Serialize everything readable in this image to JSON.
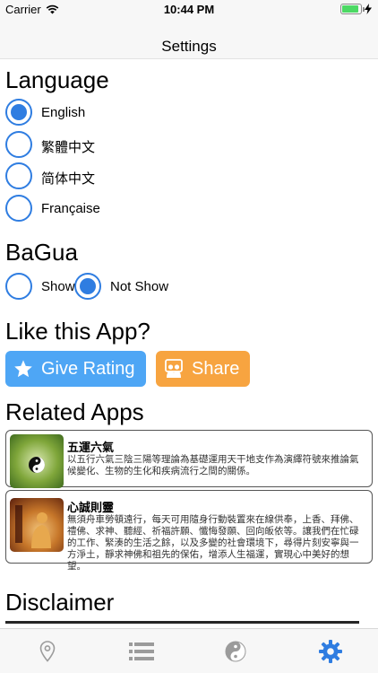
{
  "status_bar": {
    "carrier": "Carrier",
    "time": "10:44 PM",
    "battery_level": 0.9
  },
  "nav": {
    "title": "Settings"
  },
  "language": {
    "title": "Language",
    "options": [
      {
        "label": "English",
        "selected": true
      },
      {
        "label": "繁體中文",
        "selected": false
      },
      {
        "label": "简体中文",
        "selected": false
      },
      {
        "label": "Française",
        "selected": false
      }
    ]
  },
  "bagua": {
    "title": "BaGua",
    "options": [
      {
        "label": "Show",
        "selected": false
      },
      {
        "label": "Not Show",
        "selected": true
      }
    ]
  },
  "like": {
    "title": "Like this App?",
    "rating_label": "Give Rating",
    "share_label": "Share"
  },
  "related": {
    "title": "Related Apps",
    "apps": [
      {
        "name": "五運六氣",
        "description": "以五行六氣三陰三陽等理論為基礎運用天干地支作為演繹符號來推論氣候變化、生物的生化和疾病流行之間的關係。",
        "icon_text": "五運六氣"
      },
      {
        "name": "心誠則靈",
        "description": "無須舟車勞頓遠行，每天可用隨身行動裝置來在線供奉，上香、拜佛、禮佛、求神、聽經、祈福許願、懺悔發願、回向皈依等。讓我們在忙碌的工作、緊湊的生活之餘，以及多變的社會環境下，尋得片刻安寧與一方淨土，靜求神佛和祖先的保佑，增添人生福運，實現心中美好的想望。",
        "icon_text": "心誠則靈"
      }
    ]
  },
  "disclaimer": {
    "title": "Disclaimer"
  },
  "tabs": [
    {
      "name": "location-pin-icon",
      "active": false
    },
    {
      "name": "list-icon",
      "active": false
    },
    {
      "name": "yin-yang-icon",
      "active": false
    },
    {
      "name": "gear-icon",
      "active": true
    }
  ],
  "colors": {
    "accent": "#2f7de1",
    "rating": "#4ea6f5",
    "share": "#f7a440"
  }
}
